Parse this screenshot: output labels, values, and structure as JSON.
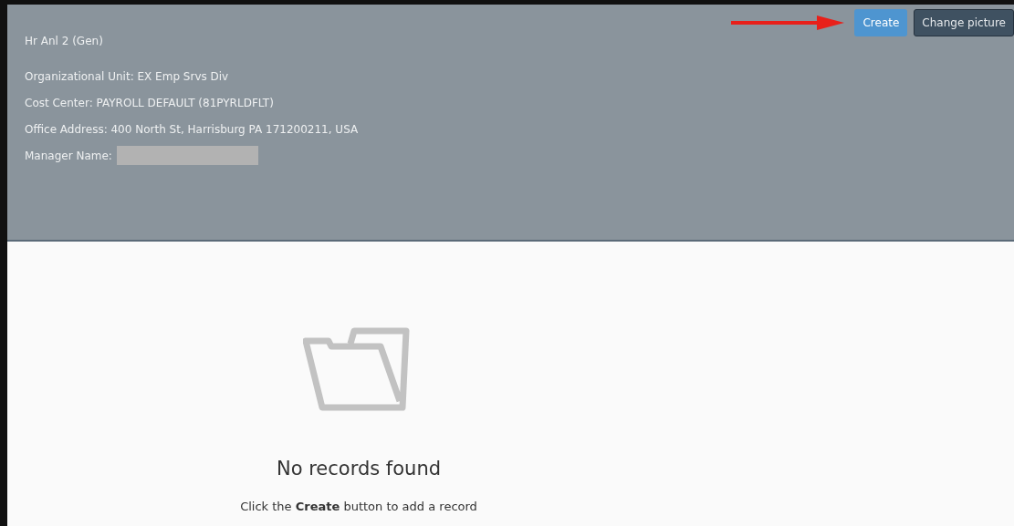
{
  "header": {
    "title": "Hr Anl 2 (Gen)",
    "details": [
      {
        "text": "Organizational Unit: EX Emp Srvs Div"
      },
      {
        "text": "Cost Center: PAYROLL DEFAULT (81PYRLDFLT)"
      },
      {
        "text": "Office Address: 400 North St, Harrisburg PA 171200211, USA"
      },
      {
        "text": "Manager Name:",
        "redacted": true
      }
    ],
    "buttons": [
      {
        "label": "Create",
        "kind": "primary"
      },
      {
        "label": "Change picture",
        "kind": "secondary"
      }
    ]
  },
  "empty_state": {
    "title": "No records found",
    "message": "Click the **Create** button to add a record"
  }
}
